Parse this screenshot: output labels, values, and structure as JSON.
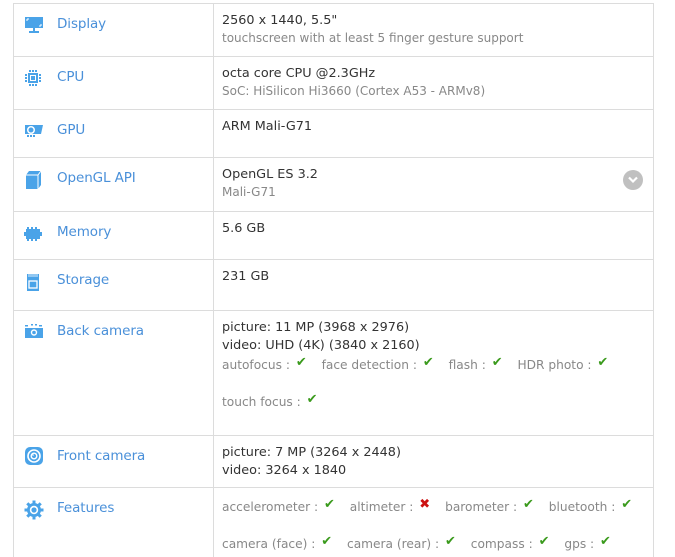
{
  "specs": [
    {
      "id": "display",
      "icon": "display-icon",
      "label": "Display",
      "primary": "2560 x 1440, 5.5\"",
      "secondary": "touchscreen with at least 5 finger gesture support"
    },
    {
      "id": "cpu",
      "icon": "cpu-icon",
      "label": "CPU",
      "primary": "octa core CPU @2.3GHz",
      "secondary": "SoC: HiSilicon Hi3660 (Cortex A53 - ARMv8)"
    },
    {
      "id": "gpu",
      "icon": "gpu-icon",
      "label": "GPU",
      "primary": "ARM Mali-G71"
    },
    {
      "id": "opengl",
      "icon": "cube-icon",
      "label": "OpenGL API",
      "primary": "OpenGL ES 3.2",
      "secondary": "Mali-G71",
      "expandable": true
    },
    {
      "id": "memory",
      "icon": "memory-icon",
      "label": "Memory",
      "primary": "5.6 GB"
    },
    {
      "id": "storage",
      "icon": "sd-card-icon",
      "label": "Storage",
      "primary": "231 GB"
    },
    {
      "id": "back-camera",
      "icon": "camera-icon",
      "label": "Back camera",
      "lines": [
        "picture: 11 MP (3968 x 2976)",
        "video: UHD (4K) (3840 x 2160)"
      ],
      "features": [
        {
          "name": "autofocus :",
          "supported": true
        },
        {
          "name": "face detection :",
          "supported": true
        },
        {
          "name": "flash :",
          "supported": true
        },
        {
          "name": "HDR photo :",
          "supported": true
        },
        {
          "name": "touch focus :",
          "supported": true
        }
      ]
    },
    {
      "id": "front-camera",
      "icon": "front-camera-icon",
      "label": "Front camera",
      "lines": [
        "picture: 7 MP (3264 x 2448)",
        "video: 3264 x 1840"
      ]
    },
    {
      "id": "features",
      "icon": "gear-icon",
      "label": "Features",
      "features": [
        {
          "name": "accelerometer :",
          "supported": true
        },
        {
          "name": "altimeter :",
          "supported": false
        },
        {
          "name": "barometer :",
          "supported": true
        },
        {
          "name": "bluetooth :",
          "supported": true
        },
        {
          "name": "camera (face) :",
          "supported": true
        },
        {
          "name": "camera (rear) :",
          "supported": true
        },
        {
          "name": "compass :",
          "supported": true
        },
        {
          "name": "gps :",
          "supported": true
        }
      ]
    }
  ],
  "colors": {
    "label": "#4a90d9",
    "icon": "#4aa3e8",
    "check": "#3a9a1c",
    "cross": "#cc1111",
    "border": "#dcdcdc"
  },
  "glyphs": {
    "check": "✔",
    "cross": "✖"
  }
}
